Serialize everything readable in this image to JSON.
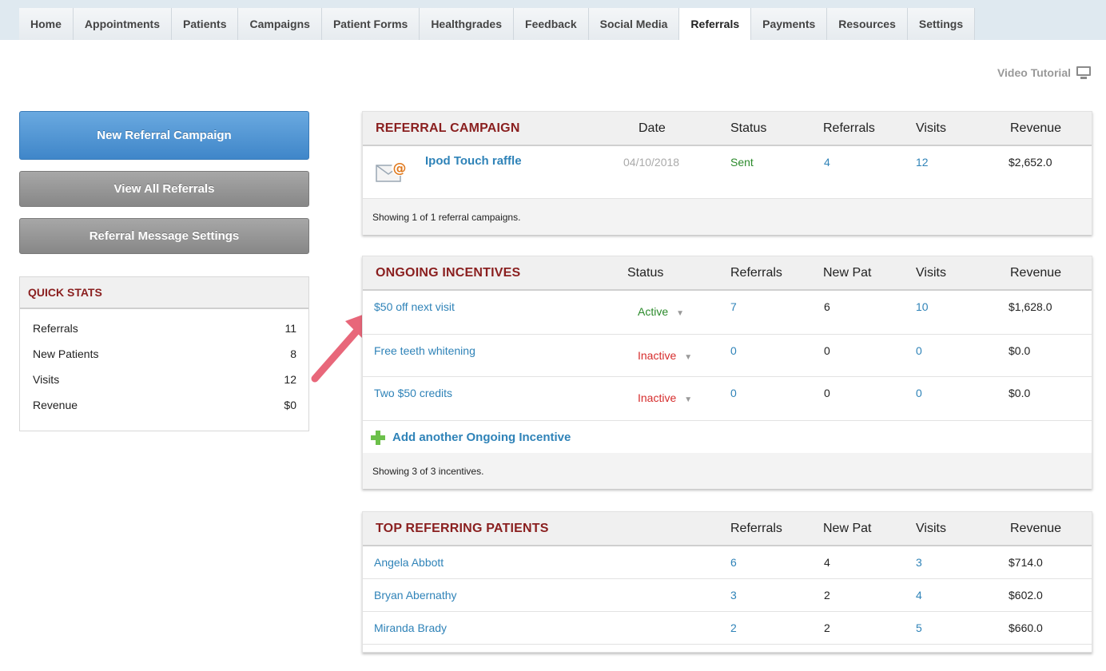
{
  "nav": {
    "tabs": [
      "Home",
      "Appointments",
      "Patients",
      "Campaigns",
      "Patient Forms",
      "Healthgrades",
      "Feedback",
      "Social Media",
      "Referrals",
      "Payments",
      "Resources",
      "Settings"
    ],
    "active": "Referrals"
  },
  "video_tutorial": {
    "label": "Video Tutorial",
    "icon": "monitor-icon"
  },
  "sidebar": {
    "new_campaign": "New Referral Campaign",
    "view_all": "View All Referrals",
    "message_settings": "Referral Message Settings",
    "quick_stats": {
      "title": "QUICK STATS",
      "rows": [
        {
          "label": "Referrals",
          "value": "11"
        },
        {
          "label": "New Patients",
          "value": "8"
        },
        {
          "label": "Visits",
          "value": "12"
        },
        {
          "label": "Revenue",
          "value": "$0"
        }
      ]
    }
  },
  "campaign": {
    "title": "REFERRAL CAMPAIGN",
    "headers": {
      "date": "Date",
      "status": "Status",
      "referrals": "Referrals",
      "visits": "Visits",
      "revenue": "Revenue"
    },
    "row": {
      "name": "Ipod Touch raffle",
      "date": "04/10/2018",
      "status": "Sent",
      "referrals": "4",
      "visits": "12",
      "revenue": "$2,652.0"
    },
    "footer": "Showing 1 of 1 referral campaigns."
  },
  "ongoing": {
    "title": "ONGOING INCENTIVES",
    "headers": {
      "status": "Status",
      "referrals": "Referrals",
      "new_pat": "New Pat",
      "visits": "Visits",
      "revenue": "Revenue"
    },
    "rows": [
      {
        "name": "$50 off next visit",
        "status": "Active",
        "referrals": "7",
        "new_pat": "6",
        "visits": "10",
        "revenue": "$1,628.0"
      },
      {
        "name": "Free teeth whitening",
        "status": "Inactive",
        "referrals": "0",
        "new_pat": "0",
        "visits": "0",
        "revenue": "$0.0"
      },
      {
        "name": "Two $50 credits",
        "status": "Inactive",
        "referrals": "0",
        "new_pat": "0",
        "visits": "0",
        "revenue": "$0.0"
      }
    ],
    "add_label": "Add another Ongoing Incentive",
    "footer": "Showing 3 of 3 incentives."
  },
  "top_patients": {
    "title": "TOP REFERRING PATIENTS",
    "headers": {
      "referrals": "Referrals",
      "new_pat": "New Pat",
      "visits": "Visits",
      "revenue": "Revenue"
    },
    "rows": [
      {
        "name": "Angela Abbott",
        "referrals": "6",
        "new_pat": "4",
        "visits": "3",
        "revenue": "$714.0"
      },
      {
        "name": "Bryan Abernathy",
        "referrals": "3",
        "new_pat": "2",
        "visits": "4",
        "revenue": "$602.0"
      },
      {
        "name": "Miranda Brady",
        "referrals": "2",
        "new_pat": "2",
        "visits": "5",
        "revenue": "$660.0"
      }
    ]
  },
  "colors": {
    "title_red": "#8a1f1f",
    "link_blue": "#2f83b8",
    "active_green": "#2b8a2b",
    "inactive_red": "#d62c2c",
    "button_blue": "#4a90d0",
    "button_gray": "#969696",
    "arrow_pink": "#e8677a"
  }
}
